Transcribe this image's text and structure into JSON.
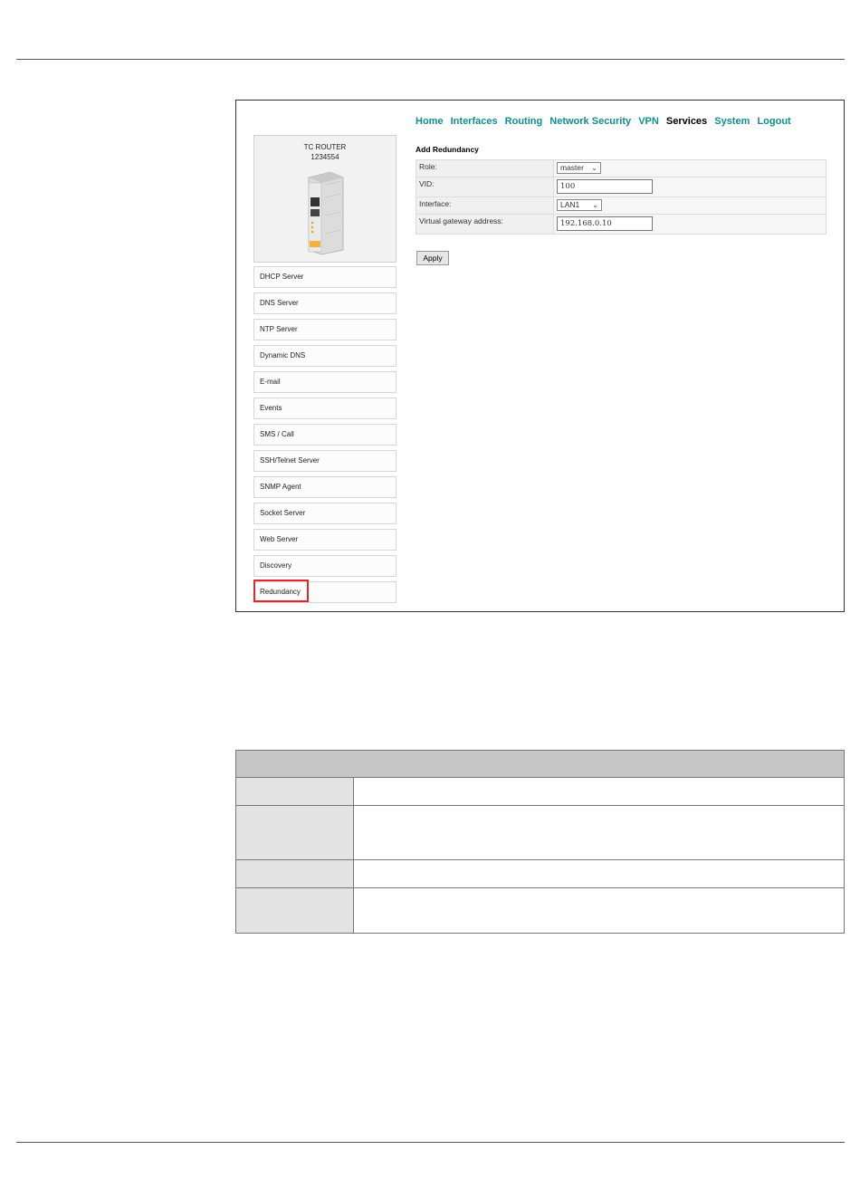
{
  "device": {
    "name": "TC ROUTER",
    "serial": "1234554"
  },
  "nav": {
    "home": "Home",
    "interfaces": "Interfaces",
    "routing": "Routing",
    "network_security": "Network Security",
    "vpn": "VPN",
    "services": "Services",
    "system": "System",
    "logout": "Logout"
  },
  "side_menu": {
    "items": [
      {
        "label": "DHCP Server"
      },
      {
        "label": "DNS Server"
      },
      {
        "label": "NTP Server"
      },
      {
        "label": "Dynamic DNS"
      },
      {
        "label": "E-mail"
      },
      {
        "label": "Events"
      },
      {
        "label": "SMS / Call"
      },
      {
        "label": "SSH/Telnet Server"
      },
      {
        "label": "SNMP Agent"
      },
      {
        "label": "Socket Server"
      },
      {
        "label": "Web Server"
      },
      {
        "label": "Discovery"
      },
      {
        "label": "Redundancy"
      }
    ],
    "active": "Redundancy"
  },
  "form": {
    "title": "Add Redundancy",
    "role_label": "Role:",
    "role_value": "master",
    "vid_label": "VID:",
    "vid_value": "100",
    "interface_label": "Interface:",
    "interface_value": "LAN1",
    "vga_label": "Virtual gateway address:",
    "vga_value": "192.168.0.10",
    "apply_label": "Apply"
  },
  "colors": {
    "nav_link": "#0e8f92",
    "highlight": "#e3262e",
    "table_header": "#c6c6c6"
  }
}
